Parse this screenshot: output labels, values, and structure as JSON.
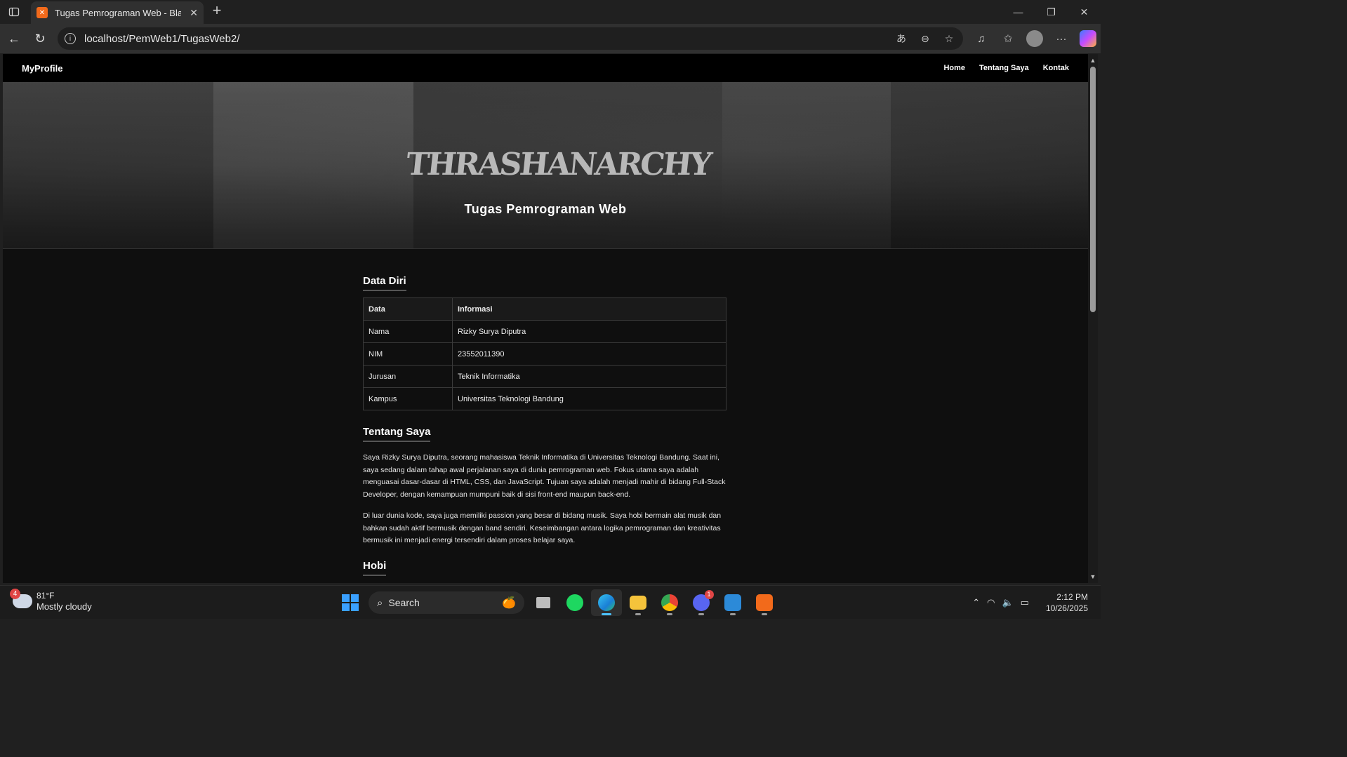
{
  "browser": {
    "tab_title": "Tugas Pemrograman Web - Black",
    "url": "localhost/PemWeb1/TugasWeb2/"
  },
  "site": {
    "brand": "MyProfile",
    "nav": [
      "Home",
      "Tentang Saya",
      "Kontak"
    ],
    "hero_logo_text": "THRASHANARCHY",
    "hero_title": "Tugas Pemrograman Web"
  },
  "data_diri": {
    "heading": "Data Diri",
    "columns": [
      "Data",
      "Informasi"
    ],
    "rows": [
      [
        "Nama",
        "Rizky Surya Diputra"
      ],
      [
        "NIM",
        "23552011390"
      ],
      [
        "Jurusan",
        "Teknik Informatika"
      ],
      [
        "Kampus",
        "Universitas Teknologi Bandung"
      ]
    ]
  },
  "tentang_saya": {
    "heading": "Tentang Saya",
    "paragraphs": [
      "Saya Rizky Surya Diputra, seorang mahasiswa Teknik Informatika di Universitas Teknologi Bandung. Saat ini, saya sedang dalam tahap awal perjalanan saya di dunia pemrograman web. Fokus utama saya adalah menguasai dasar-dasar di HTML, CSS, dan JavaScript. Tujuan saya adalah menjadi mahir di bidang Full-Stack Developer, dengan kemampuan mumpuni baik di sisi front-end maupun back-end.",
      "Di luar dunia kode, saya juga memiliki passion yang besar di bidang musik. Saya hobi bermain alat musik dan bahkan sudah aktif bermusik dengan band sendiri. Keseimbangan antara logika pemrograman dan kreativitas bermusik ini menjadi energi tersendiri dalam proses belajar saya."
    ]
  },
  "hobi": {
    "heading": "Hobi"
  },
  "taskbar": {
    "weather_temp": "81°F",
    "weather_desc": "Mostly cloudy",
    "weather_badge": "4",
    "search_label": "Search",
    "discord_badge": "1",
    "time": "2:12 PM",
    "date": "10/26/2025"
  }
}
